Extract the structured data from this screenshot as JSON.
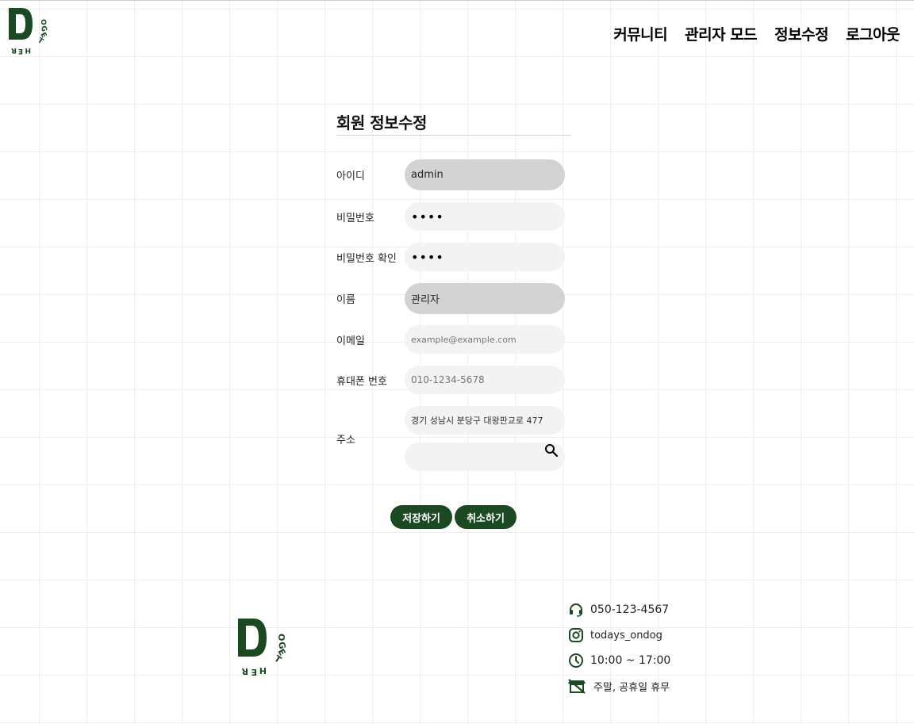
{
  "colors": {
    "brand": "#1b4a22",
    "readonly_field": "#d3d3d3",
    "editable_field": "#f3f3f3"
  },
  "header": {
    "logo_icon": "dogether-logo",
    "nav": [
      "커뮤니티",
      "관리자 모드",
      "정보수정",
      "로그아웃"
    ]
  },
  "form": {
    "title": "회원 정보수정",
    "fields": {
      "id": {
        "label": "아이디",
        "value": "admin"
      },
      "password": {
        "label": "비밀번호",
        "value": "••••"
      },
      "password_confirm": {
        "label": "비밀번호 확인",
        "value": "••••"
      },
      "name": {
        "label": "이름",
        "value": "관리자"
      },
      "email": {
        "label": "이메일",
        "placeholder": "example@example.com"
      },
      "phone": {
        "label": "휴대폰 번호",
        "placeholder": "010-1234-5678"
      },
      "address": {
        "label": "주소",
        "value": "경기 성남시 분당구 대왕판교로 477",
        "detail_value": ""
      }
    },
    "save_label": "저장하기",
    "cancel_label": "취소하기"
  },
  "footer": {
    "logo_icon": "dogether-logo",
    "phone": "050-123-4567",
    "instagram": "todays_ondog",
    "hours": "10:00 ~ 17:00",
    "closed": "주말, 공휴일 휴무"
  }
}
